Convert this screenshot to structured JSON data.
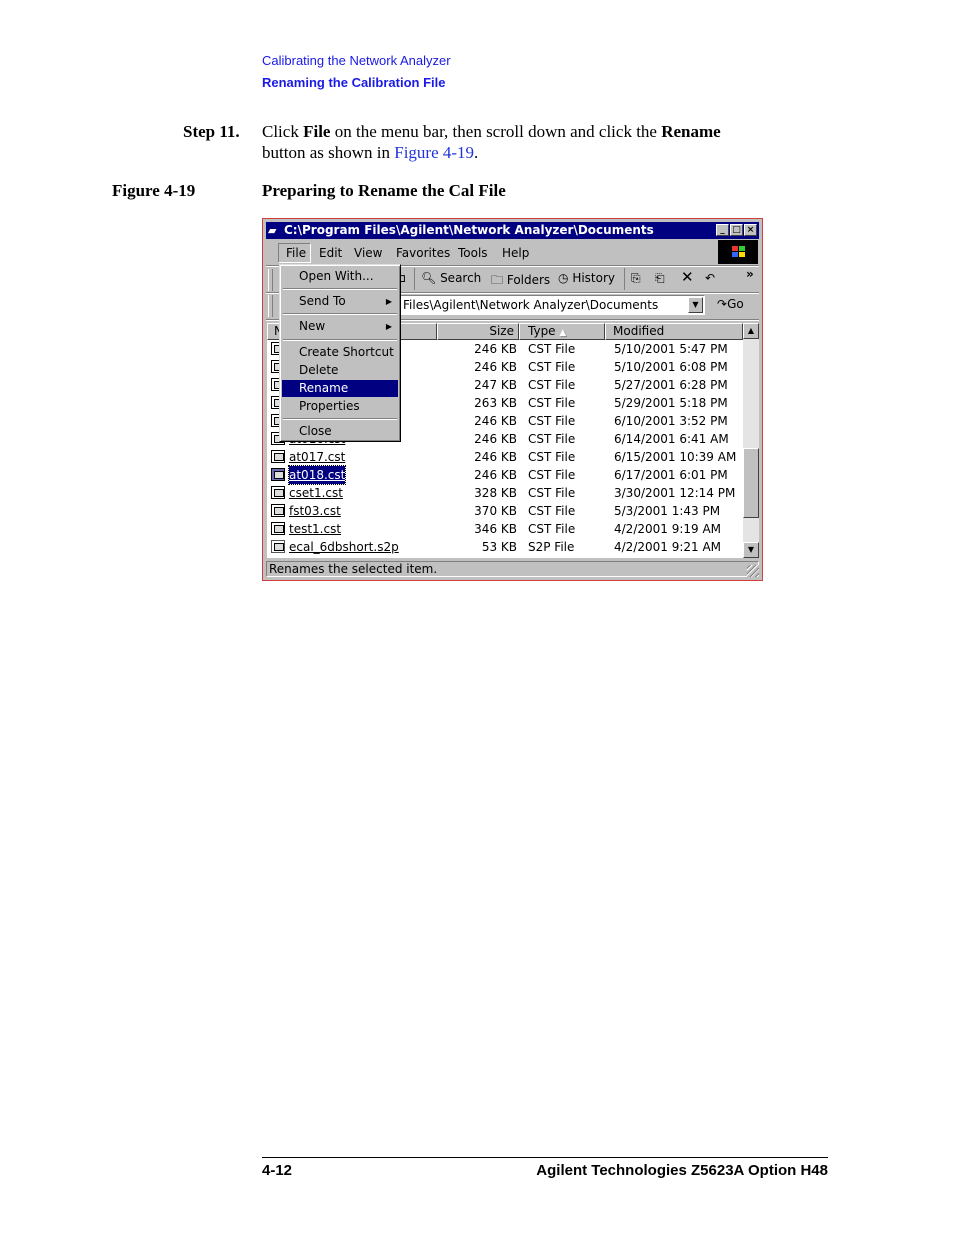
{
  "header": {
    "chapter": "Calibrating the Network Analyzer",
    "section": "Renaming the Calibration File"
  },
  "step": {
    "label": "Step 11.",
    "t1": "Click ",
    "b1": "File",
    "t2": " on the menu bar, then scroll down and click the ",
    "b2": "Rename",
    "t3": "button as shown in ",
    "link": "Figure 4-19",
    "t4": "."
  },
  "figure": {
    "number": "Figure 4-19",
    "caption": "Preparing to Rename the Cal File"
  },
  "window": {
    "title": "C:\\Program Files\\Agilent\\Network Analyzer\\Documents",
    "menubar": [
      "File",
      "Edit",
      "View",
      "Favorites",
      "Tools",
      "Help"
    ],
    "toolbar": {
      "search": "Search",
      "folders": "Folders",
      "history": "History",
      "more": "»"
    },
    "address": {
      "value": "Files\\Agilent\\Network Analyzer\\Documents",
      "go": "Go"
    },
    "columns": {
      "name": "N",
      "size": "Size",
      "type": "Type",
      "modified": "Modified"
    },
    "file_menu": [
      "Open With...",
      "Send To",
      "New",
      "Create Shortcut",
      "Delete",
      "Rename",
      "Properties",
      "Close"
    ],
    "files": [
      {
        "name": "",
        "size": "246 KB",
        "type": "CST File",
        "modified": "5/10/2001 5:47 PM"
      },
      {
        "name": "",
        "size": "246 KB",
        "type": "CST File",
        "modified": "5/10/2001 6:08 PM"
      },
      {
        "name": "",
        "size": "247 KB",
        "type": "CST File",
        "modified": "5/27/2001 6:28 PM"
      },
      {
        "name": "",
        "size": "263 KB",
        "type": "CST File",
        "modified": "5/29/2001 5:18 PM"
      },
      {
        "name": "",
        "size": "246 KB",
        "type": "CST File",
        "modified": "6/10/2001 3:52 PM"
      },
      {
        "name": "at016.cst",
        "size": "246 KB",
        "type": "CST File",
        "modified": "6/14/2001 6:41 AM"
      },
      {
        "name": "at017.cst",
        "size": "246 KB",
        "type": "CST File",
        "modified": "6/15/2001 10:39 AM"
      },
      {
        "name": "at018.cst",
        "size": "246 KB",
        "type": "CST File",
        "modified": "6/17/2001 6:01 PM"
      },
      {
        "name": "cset1.cst",
        "size": "328 KB",
        "type": "CST File",
        "modified": "3/30/2001 12:14 PM"
      },
      {
        "name": "fst03.cst",
        "size": "370 KB",
        "type": "CST File",
        "modified": "5/3/2001 1:43 PM"
      },
      {
        "name": "test1.cst",
        "size": "346 KB",
        "type": "CST File",
        "modified": "4/2/2001 9:19 AM"
      },
      {
        "name": "ecal_6dbshort.s2p",
        "size": "53 KB",
        "type": "S2P File",
        "modified": "4/2/2001 9:21 AM"
      }
    ],
    "status": "Renames the selected item."
  },
  "footer": {
    "page": "4-12",
    "product": "Agilent Technologies Z5623A Option H48"
  }
}
